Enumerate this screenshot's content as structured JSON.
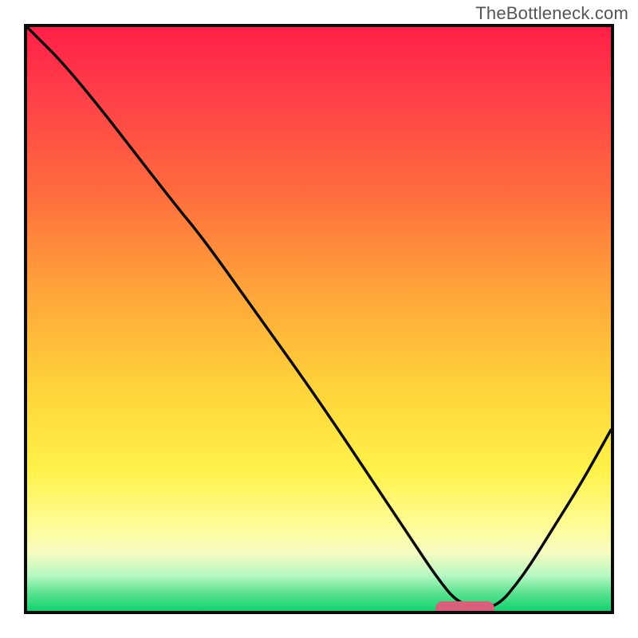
{
  "watermark": "TheBottleneck.com",
  "chart_data": {
    "type": "line",
    "title": "",
    "xlabel": "",
    "ylabel": "",
    "xlim": [
      0,
      100
    ],
    "ylim": [
      0,
      100
    ],
    "series": [
      {
        "name": "curve",
        "x": [
          0,
          8,
          25,
          30,
          40,
          50,
          60,
          66,
          70,
          74,
          80,
          85,
          90,
          95,
          100
        ],
        "y": [
          100,
          92,
          70,
          64,
          50,
          36,
          21,
          12,
          6,
          1,
          0,
          6,
          14,
          22,
          31
        ]
      }
    ],
    "bottleneck_marker": {
      "x_start": 70,
      "x_end": 80,
      "y": 0
    },
    "background_gradient": {
      "top": "#ff1f47",
      "mid": "#ffd43a",
      "bottom": "#12d26f"
    },
    "grid": false,
    "legend": false
  }
}
